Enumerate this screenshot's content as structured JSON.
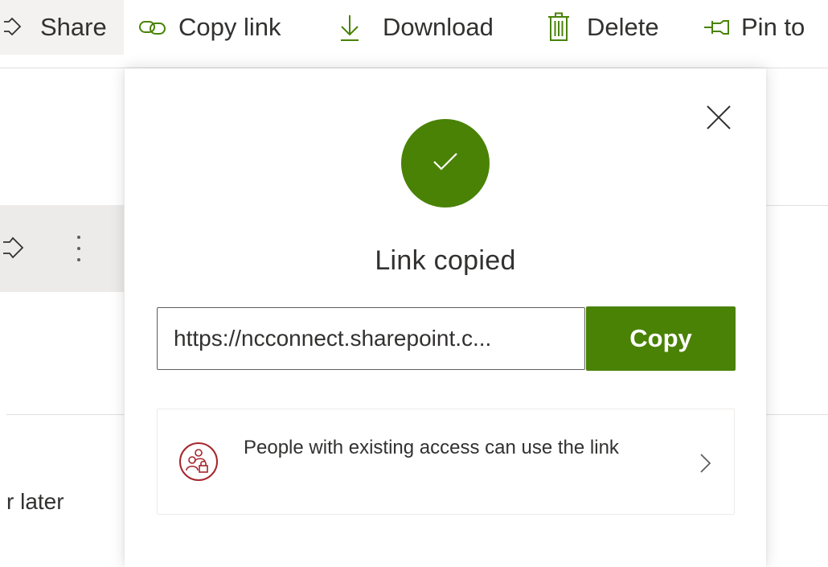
{
  "command_bar": {
    "share_label": "Share",
    "copy_link_label": "Copy link",
    "download_label": "Download",
    "delete_label": "Delete",
    "pin_label": "Pin to"
  },
  "background": {
    "row_text": "r later"
  },
  "dialog": {
    "title": "Link copied",
    "link_value": "https://ncconnect.sharepoint.c...",
    "copy_button_label": "Copy",
    "access_text": "People with existing access can use the link"
  },
  "colors": {
    "accent_green": "#498205",
    "access_icon_red": "#a4262c"
  },
  "icons": {
    "share": "share-icon",
    "copy_link": "link-icon",
    "download": "download-arrow-icon",
    "delete": "trash-icon",
    "pin": "pin-icon",
    "close": "close-icon",
    "success": "checkmark-icon",
    "access": "people-lock-icon",
    "chevron": "chevron-right-icon",
    "more": "more-vertical-icon"
  }
}
